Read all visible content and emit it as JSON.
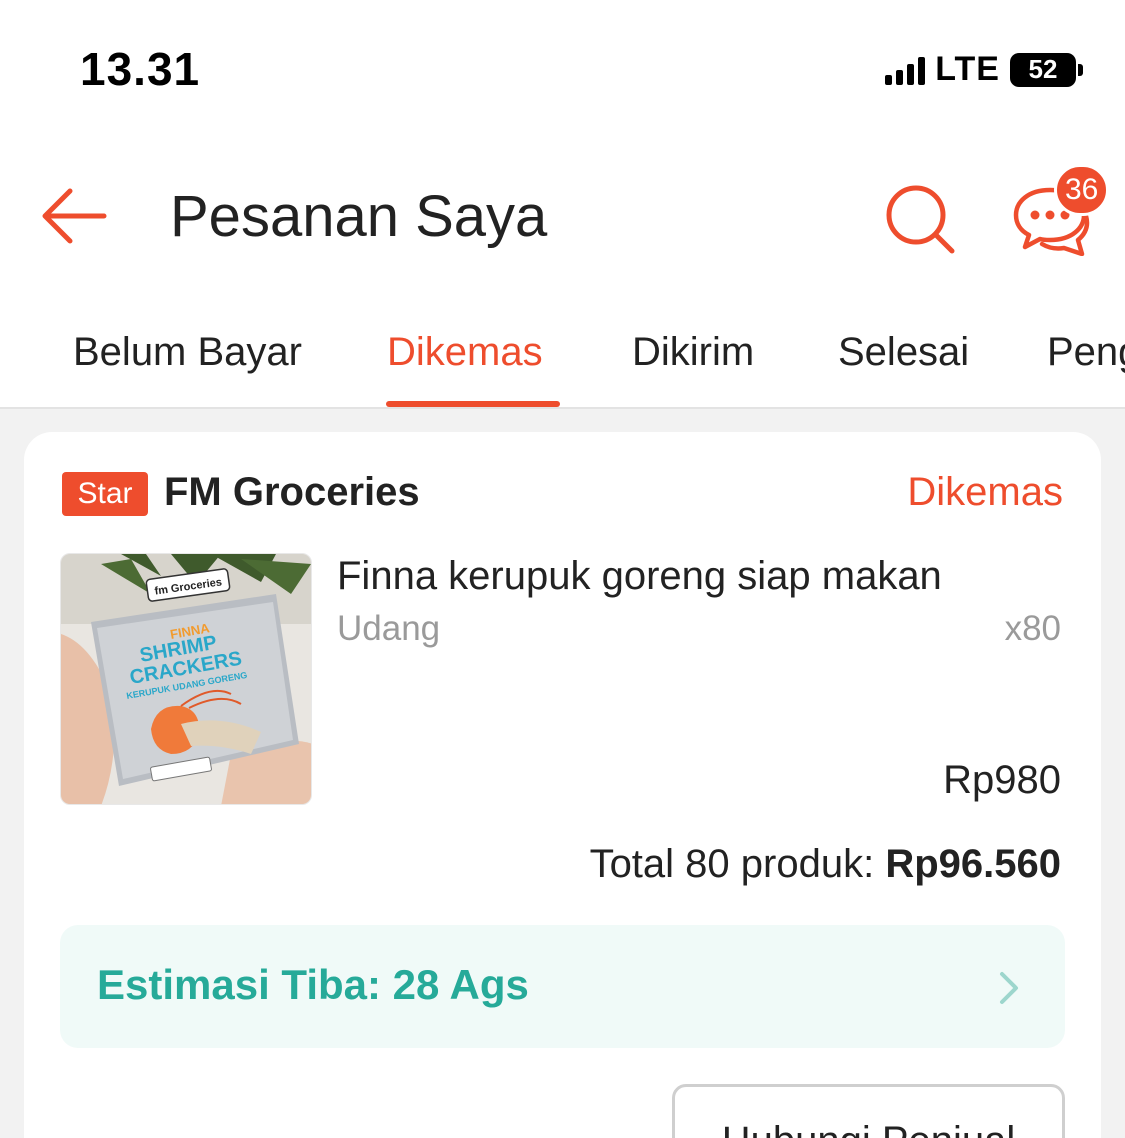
{
  "status_bar": {
    "time": "13.31",
    "network": "LTE",
    "battery": "52"
  },
  "header": {
    "title": "Pesanan Saya",
    "chat_badge_count": "36",
    "icons": [
      "back-arrow-icon",
      "search-icon",
      "chat-icon"
    ]
  },
  "tabs": [
    {
      "label": "Belum Bayar",
      "active": false
    },
    {
      "label": "Dikemas",
      "active": true
    },
    {
      "label": "Dikirim",
      "active": false
    },
    {
      "label": "Selesai",
      "active": false
    },
    {
      "label": "Peng",
      "active": false
    }
  ],
  "order": {
    "shop_badge": "Star",
    "shop_name": "FM Groceries",
    "status": "Dikemas",
    "product": {
      "name": "Finna kerupuk goreng siap makan",
      "variant": "Udang",
      "quantity": "x80",
      "price": "Rp980",
      "image_text": {
        "store": "fm Groceries",
        "brand": "FINNA",
        "line1": "SHRIMP",
        "line2": "CRACKERS",
        "subtitle": "KERUPUK UDANG GORENG"
      }
    },
    "total_label": "Total 80 produk:",
    "total_amount": "Rp96.560",
    "eta": "Estimasi Tiba: 28 Ags",
    "contact_button": "Hubungi Penjual"
  },
  "colors": {
    "accent": "#ee4d2d",
    "eta_text": "#26aa99",
    "eta_bg": "#f0faf8"
  }
}
